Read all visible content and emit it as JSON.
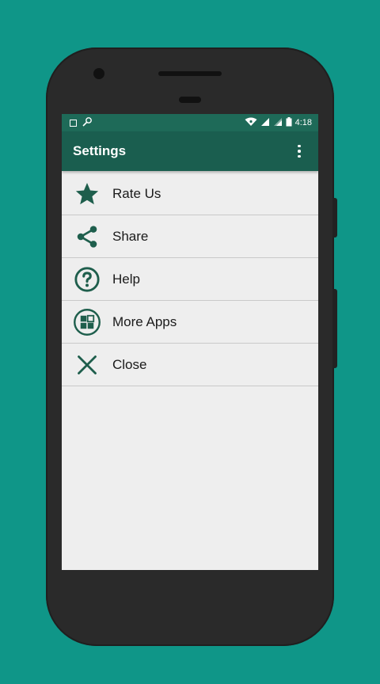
{
  "status_bar": {
    "time": "4:18"
  },
  "app_bar": {
    "title": "Settings",
    "overflow_icon": "more-vert-icon"
  },
  "menu": {
    "items": [
      {
        "label": "Rate Us",
        "icon": "star-icon"
      },
      {
        "label": "Share",
        "icon": "share-icon"
      },
      {
        "label": "Help",
        "icon": "help-circle-icon"
      },
      {
        "label": "More Apps",
        "icon": "apps-grid-icon"
      },
      {
        "label": "Close",
        "icon": "close-icon"
      }
    ]
  },
  "colors": {
    "background": "#0f9688",
    "status_bar": "#1e6a58",
    "app_bar": "#1a5e4f",
    "icon": "#1e5e4c",
    "list_bg": "#eeeeee"
  }
}
